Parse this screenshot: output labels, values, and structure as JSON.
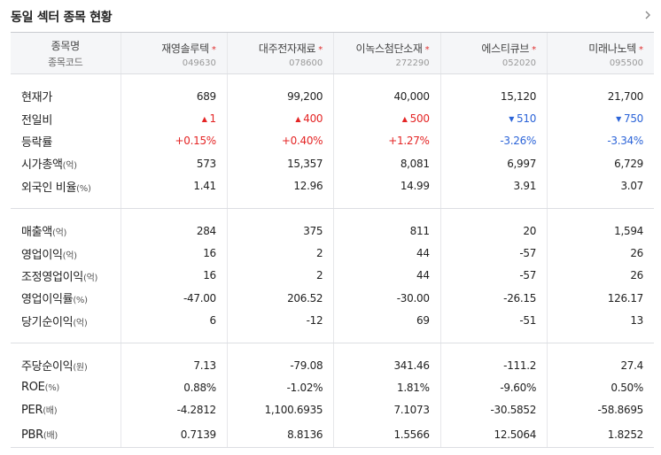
{
  "title": "동일 섹터 종목 현황",
  "header": {
    "name_label": "종목명",
    "code_label": "종목코드"
  },
  "companies": [
    {
      "name": "재영솔루텍",
      "code": "049630"
    },
    {
      "name": "대주전자재료",
      "code": "078600"
    },
    {
      "name": "이녹스첨단소재",
      "code": "272290"
    },
    {
      "name": "에스티큐브",
      "code": "052020"
    },
    {
      "name": "미래나노텍",
      "code": "095500"
    }
  ],
  "colors": {
    "up": "#e42525",
    "down": "#2c64d8",
    "star": "#e03030"
  },
  "groups": [
    [
      {
        "label": "현재가",
        "unit": "",
        "values": [
          "689",
          "99,200",
          "40,000",
          "15,120",
          "21,700"
        ]
      },
      {
        "label": "전일비",
        "unit": "",
        "type": "change",
        "dirs": [
          "up",
          "up",
          "up",
          "down",
          "down"
        ],
        "values": [
          "1",
          "400",
          "500",
          "510",
          "750"
        ]
      },
      {
        "label": "등락률",
        "unit": "",
        "type": "rate",
        "dirs": [
          "up",
          "up",
          "up",
          "down",
          "down"
        ],
        "values": [
          "+0.15%",
          "+0.40%",
          "+1.27%",
          "-3.26%",
          "-3.34%"
        ]
      },
      {
        "label": "시가총액",
        "unit": "(억)",
        "values": [
          "573",
          "15,357",
          "8,081",
          "6,997",
          "6,729"
        ]
      },
      {
        "label": "외국인 비율",
        "unit": "(%)",
        "values": [
          "1.41",
          "12.96",
          "14.99",
          "3.91",
          "3.07"
        ]
      }
    ],
    [
      {
        "label": "매출액",
        "unit": "(억)",
        "values": [
          "284",
          "375",
          "811",
          "20",
          "1,594"
        ]
      },
      {
        "label": "영업이익",
        "unit": "(억)",
        "values": [
          "16",
          "2",
          "44",
          "-57",
          "26"
        ]
      },
      {
        "label": "조정영업이익",
        "unit": "(억)",
        "values": [
          "16",
          "2",
          "44",
          "-57",
          "26"
        ]
      },
      {
        "label": "영업이익률",
        "unit": "(%)",
        "values": [
          "-47.00",
          "206.52",
          "-30.00",
          "-26.15",
          "126.17"
        ]
      },
      {
        "label": "당기순이익",
        "unit": "(억)",
        "values": [
          "6",
          "-12",
          "69",
          "-51",
          "13"
        ]
      }
    ],
    [
      {
        "label": "주당순이익",
        "unit": "(원)",
        "values": [
          "7.13",
          "-79.08",
          "341.46",
          "-111.2",
          "27.4"
        ]
      },
      {
        "label": "ROE",
        "unit": "(%)",
        "values": [
          "0.88%",
          "-1.02%",
          "1.81%",
          "-9.60%",
          "0.50%"
        ]
      },
      {
        "label": "PER",
        "unit": "(배)",
        "values": [
          "-4.2812",
          "1,100.6935",
          "7.1073",
          "-30.5852",
          "-58.8695"
        ]
      },
      {
        "label": "PBR",
        "unit": "(배)",
        "values": [
          "0.7139",
          "8.8136",
          "1.5566",
          "12.5064",
          "1.8252"
        ]
      }
    ]
  ]
}
